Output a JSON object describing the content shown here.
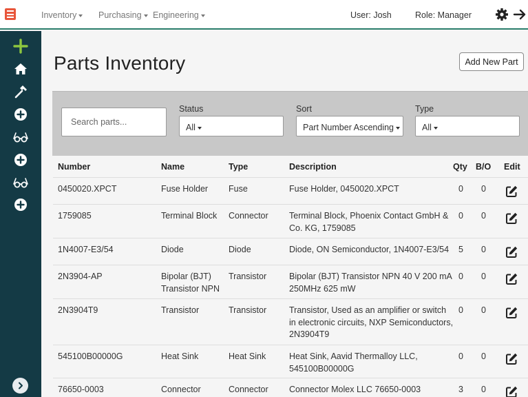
{
  "topnav": {
    "menus": [
      {
        "label": "Inventory"
      },
      {
        "label": "Purchasing"
      },
      {
        "label": "Engineering"
      }
    ],
    "user": "User: Josh",
    "role": "Role: Manager",
    "icons": [
      "menu-icon",
      "gear-icon",
      "logout-arrow-icon"
    ]
  },
  "sidebar": {
    "icons": [
      "plus-icon",
      "home-icon",
      "hammer-icon",
      "circle-plus-icon",
      "glasses-icon",
      "circle-plus-icon",
      "glasses-icon",
      "circle-plus-icon",
      "chevron-right-icon"
    ],
    "accent": "#8dc63f",
    "background": "#143a45"
  },
  "page": {
    "title": "Parts Inventory",
    "add_button": "Add New Part"
  },
  "filters": {
    "search_placeholder": "Search parts...",
    "status_label": "Status",
    "status_value": "All",
    "sort_label": "Sort",
    "sort_value": "Part Number Ascending",
    "type_label": "Type",
    "type_value": "All"
  },
  "table": {
    "columns": [
      "Number",
      "Name",
      "Type",
      "Description",
      "Qty",
      "B/O",
      "Edit"
    ],
    "rows": [
      {
        "number": "0450020.XPCT",
        "name": [
          "Fuse Holder"
        ],
        "type": "Fuse",
        "description": [
          "Fuse Holder, 0450020.XPCT"
        ],
        "qty": "0",
        "bo": "0"
      },
      {
        "number": "1759085",
        "name": [
          "Terminal Block"
        ],
        "type": "Connector",
        "description": [
          "Terminal Block, Phoenix Contact GmbH &",
          "Co. KG, 1759085"
        ],
        "qty": "0",
        "bo": "0"
      },
      {
        "number": "1N4007-E3/54",
        "name": [
          "Diode"
        ],
        "type": "Diode",
        "description": [
          "Diode, ON Semiconductor, 1N4007-E3/54"
        ],
        "qty": "5",
        "bo": "0"
      },
      {
        "number": "2N3904-AP",
        "name": [
          "Bipolar (BJT)",
          "Transistor NPN"
        ],
        "type": "Transistor",
        "description": [
          "Bipolar (BJT) Transistor NPN 40 V 200 mA",
          "250MHz 625 mW"
        ],
        "qty": "0",
        "bo": "0"
      },
      {
        "number": "2N3904T9",
        "name": [
          "Transistor"
        ],
        "type": "Transistor",
        "description": [
          "Transistor, Used as an amplifier or switch",
          "in electronic circuits, NXP Semiconductors,",
          "2N3904T9"
        ],
        "qty": "0",
        "bo": "0"
      },
      {
        "number": "545100B00000G",
        "name": [
          "Heat Sink"
        ],
        "type": "Heat Sink",
        "description": [
          "Heat Sink, Aavid Thermalloy LLC,",
          "545100B00000G"
        ],
        "qty": "0",
        "bo": "0"
      },
      {
        "number": "76650-0003",
        "name": [
          "Connector"
        ],
        "type": "Connector",
        "description": [
          "Connector Molex LLC 76650-0003"
        ],
        "qty": "3",
        "bo": "0"
      }
    ]
  }
}
